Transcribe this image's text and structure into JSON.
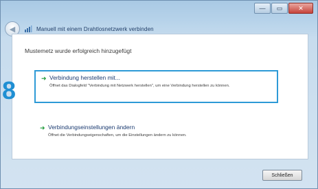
{
  "window": {
    "controls": {
      "minimize": "—",
      "maximize": "▭",
      "close": "✕"
    }
  },
  "wizard": {
    "title": "Manuell mit einem Drahtlosnetzwerk verbinden",
    "back_glyph": "◀"
  },
  "content": {
    "success_message": "Mustemetz wurde erfolgreich hinzugefügt",
    "options": [
      {
        "title": "Verbindung herstellen mit...",
        "description": "Öffnet das Dialogfeld \"Verbindung mit Netzwerk herstellen\", um eine Verbindung herstellen zu können.",
        "highlighted": true
      },
      {
        "title": "Verbindungseinstellungen ändern",
        "description": "Öffnet die Verbindungseigenschaften, um die Einstellungen ändern zu können.",
        "highlighted": false
      }
    ]
  },
  "annotation": {
    "step_number": "8",
    "color": "#1f8fd3"
  },
  "footer": {
    "close_button": "Schließen"
  },
  "colors": {
    "arrow": "#1f9a3a",
    "link": "#1a3a70",
    "highlight_border": "#2d9ad6"
  }
}
